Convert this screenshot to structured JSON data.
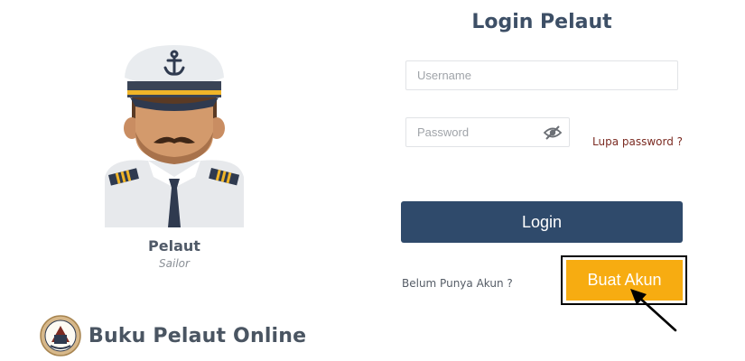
{
  "profile": {
    "title": "Pelaut",
    "subtitle": "Sailor"
  },
  "brand": {
    "name": "Buku Pelaut Online"
  },
  "login": {
    "title": "Login Pelaut",
    "username_placeholder": "Username",
    "password_placeholder": "Password",
    "forgot_label": "Lupa password ?",
    "login_label": "Login",
    "no_account_label": "Belum Punya Akun ?",
    "create_label": "Buat Akun"
  },
  "icons": {
    "avatar": "sailor-avatar-icon",
    "logo": "emblem-logo-icon",
    "password_toggle": "eye-slash-icon",
    "annotation": "arrow-icon"
  },
  "colors": {
    "primary": "#2f4a6b",
    "accent": "#f7ac11",
    "link": "#7b2b22",
    "heading": "#3d4f66"
  }
}
